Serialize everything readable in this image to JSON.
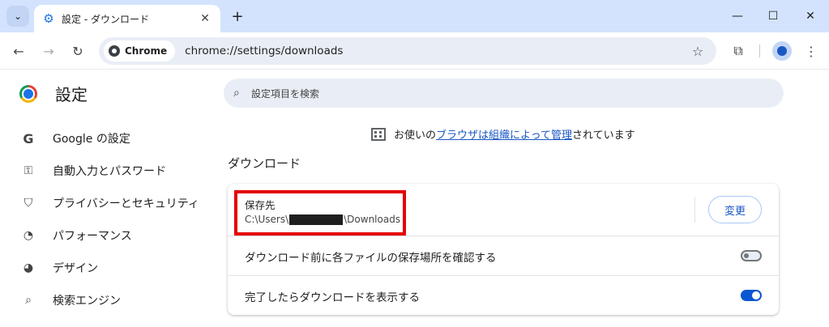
{
  "browser": {
    "tab_title": "設定 - ダウンロード",
    "url": "chrome://settings/downloads",
    "chip_label": "Chrome",
    "icons": {
      "tab_search": "chevron-down-icon",
      "tab": "gear-icon",
      "close": "close-icon",
      "new_tab": "plus-icon",
      "back": "back-arrow-icon",
      "forward": "forward-arrow-icon",
      "reload": "reload-icon",
      "bookmark": "star-icon",
      "extensions": "puzzle-icon",
      "profile": "avatar-icon",
      "menu": "kebab-menu-icon"
    }
  },
  "settings": {
    "title": "設定",
    "search_placeholder": "設定項目を検索",
    "managed_notice": {
      "prefix": "お使いの",
      "link": "ブラウザは組織によって管理",
      "suffix": "されています"
    }
  },
  "sidebar": {
    "items": [
      {
        "label": "Google の設定",
        "icon": "google-icon"
      },
      {
        "label": "自動入力とパスワード",
        "icon": "key-icon"
      },
      {
        "label": "プライバシーとセキュリティ",
        "icon": "shield-icon"
      },
      {
        "label": "パフォーマンス",
        "icon": "gauge-icon"
      },
      {
        "label": "デザイン",
        "icon": "palette-icon"
      },
      {
        "label": "検索エンジン",
        "icon": "search-icon"
      }
    ]
  },
  "downloads": {
    "section_title": "ダウンロード",
    "location_label": "保存先",
    "location_path_prefix": "C:\\Users\\",
    "location_path_suffix": "\\Downloads",
    "change_button": "変更",
    "ask_before_label": "ダウンロード前に各ファイルの保存場所を確認する",
    "ask_before_enabled": false,
    "show_when_done_label": "完了したらダウンロードを表示する",
    "show_when_done_enabled": true
  },
  "colors": {
    "accent": "#0b57d0",
    "highlight": "#e50000",
    "tabstrip": "#d3e3fd"
  }
}
